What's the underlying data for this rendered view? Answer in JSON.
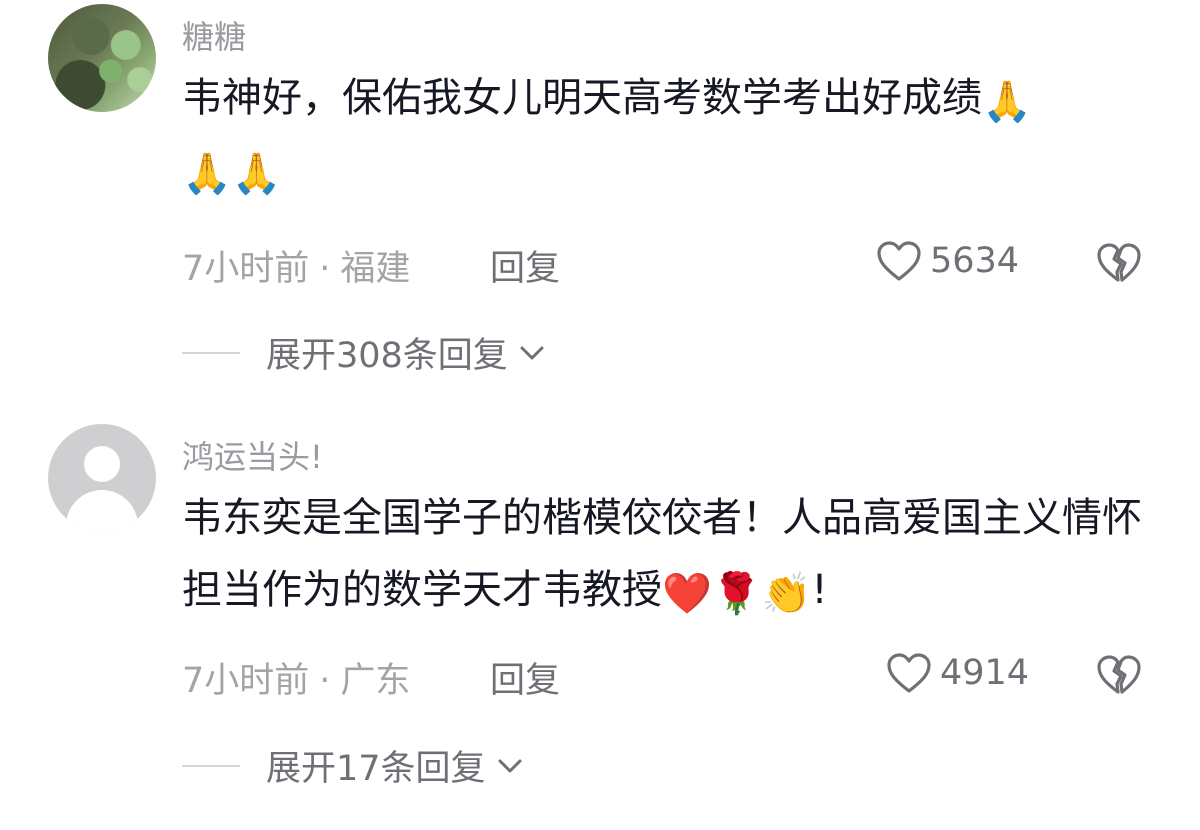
{
  "comments": [
    {
      "username": "糖糖",
      "text": "韦神好，保佑我女儿明天高考数学考出好成绩",
      "emojis": [
        "🙏",
        "🙏",
        "🙏"
      ],
      "time": "7小时前",
      "separator": "·",
      "location": "福建",
      "reply_label": "回复",
      "like_count": "5634",
      "expand_label": "展开308条回复"
    },
    {
      "username": "鸿运当头!",
      "text": "韦东奕是全国学子的楷模佼佼者！人品高爱国主义情怀担当作为的数学天才韦教授",
      "emojis": [
        "❤️",
        "🌹",
        "👏"
      ],
      "trailing": "!",
      "time": "7小时前",
      "separator": "·",
      "location": "广东",
      "reply_label": "回复",
      "like_count": "4914",
      "expand_label": "展开17条回复"
    }
  ],
  "icons": {
    "like": "heart-outline-icon",
    "dislike": "broken-heart-icon",
    "expand": "chevron-down-icon"
  },
  "colors": {
    "text": "#161823",
    "secondary": "#9a9ba0",
    "action": "#6f7076"
  }
}
